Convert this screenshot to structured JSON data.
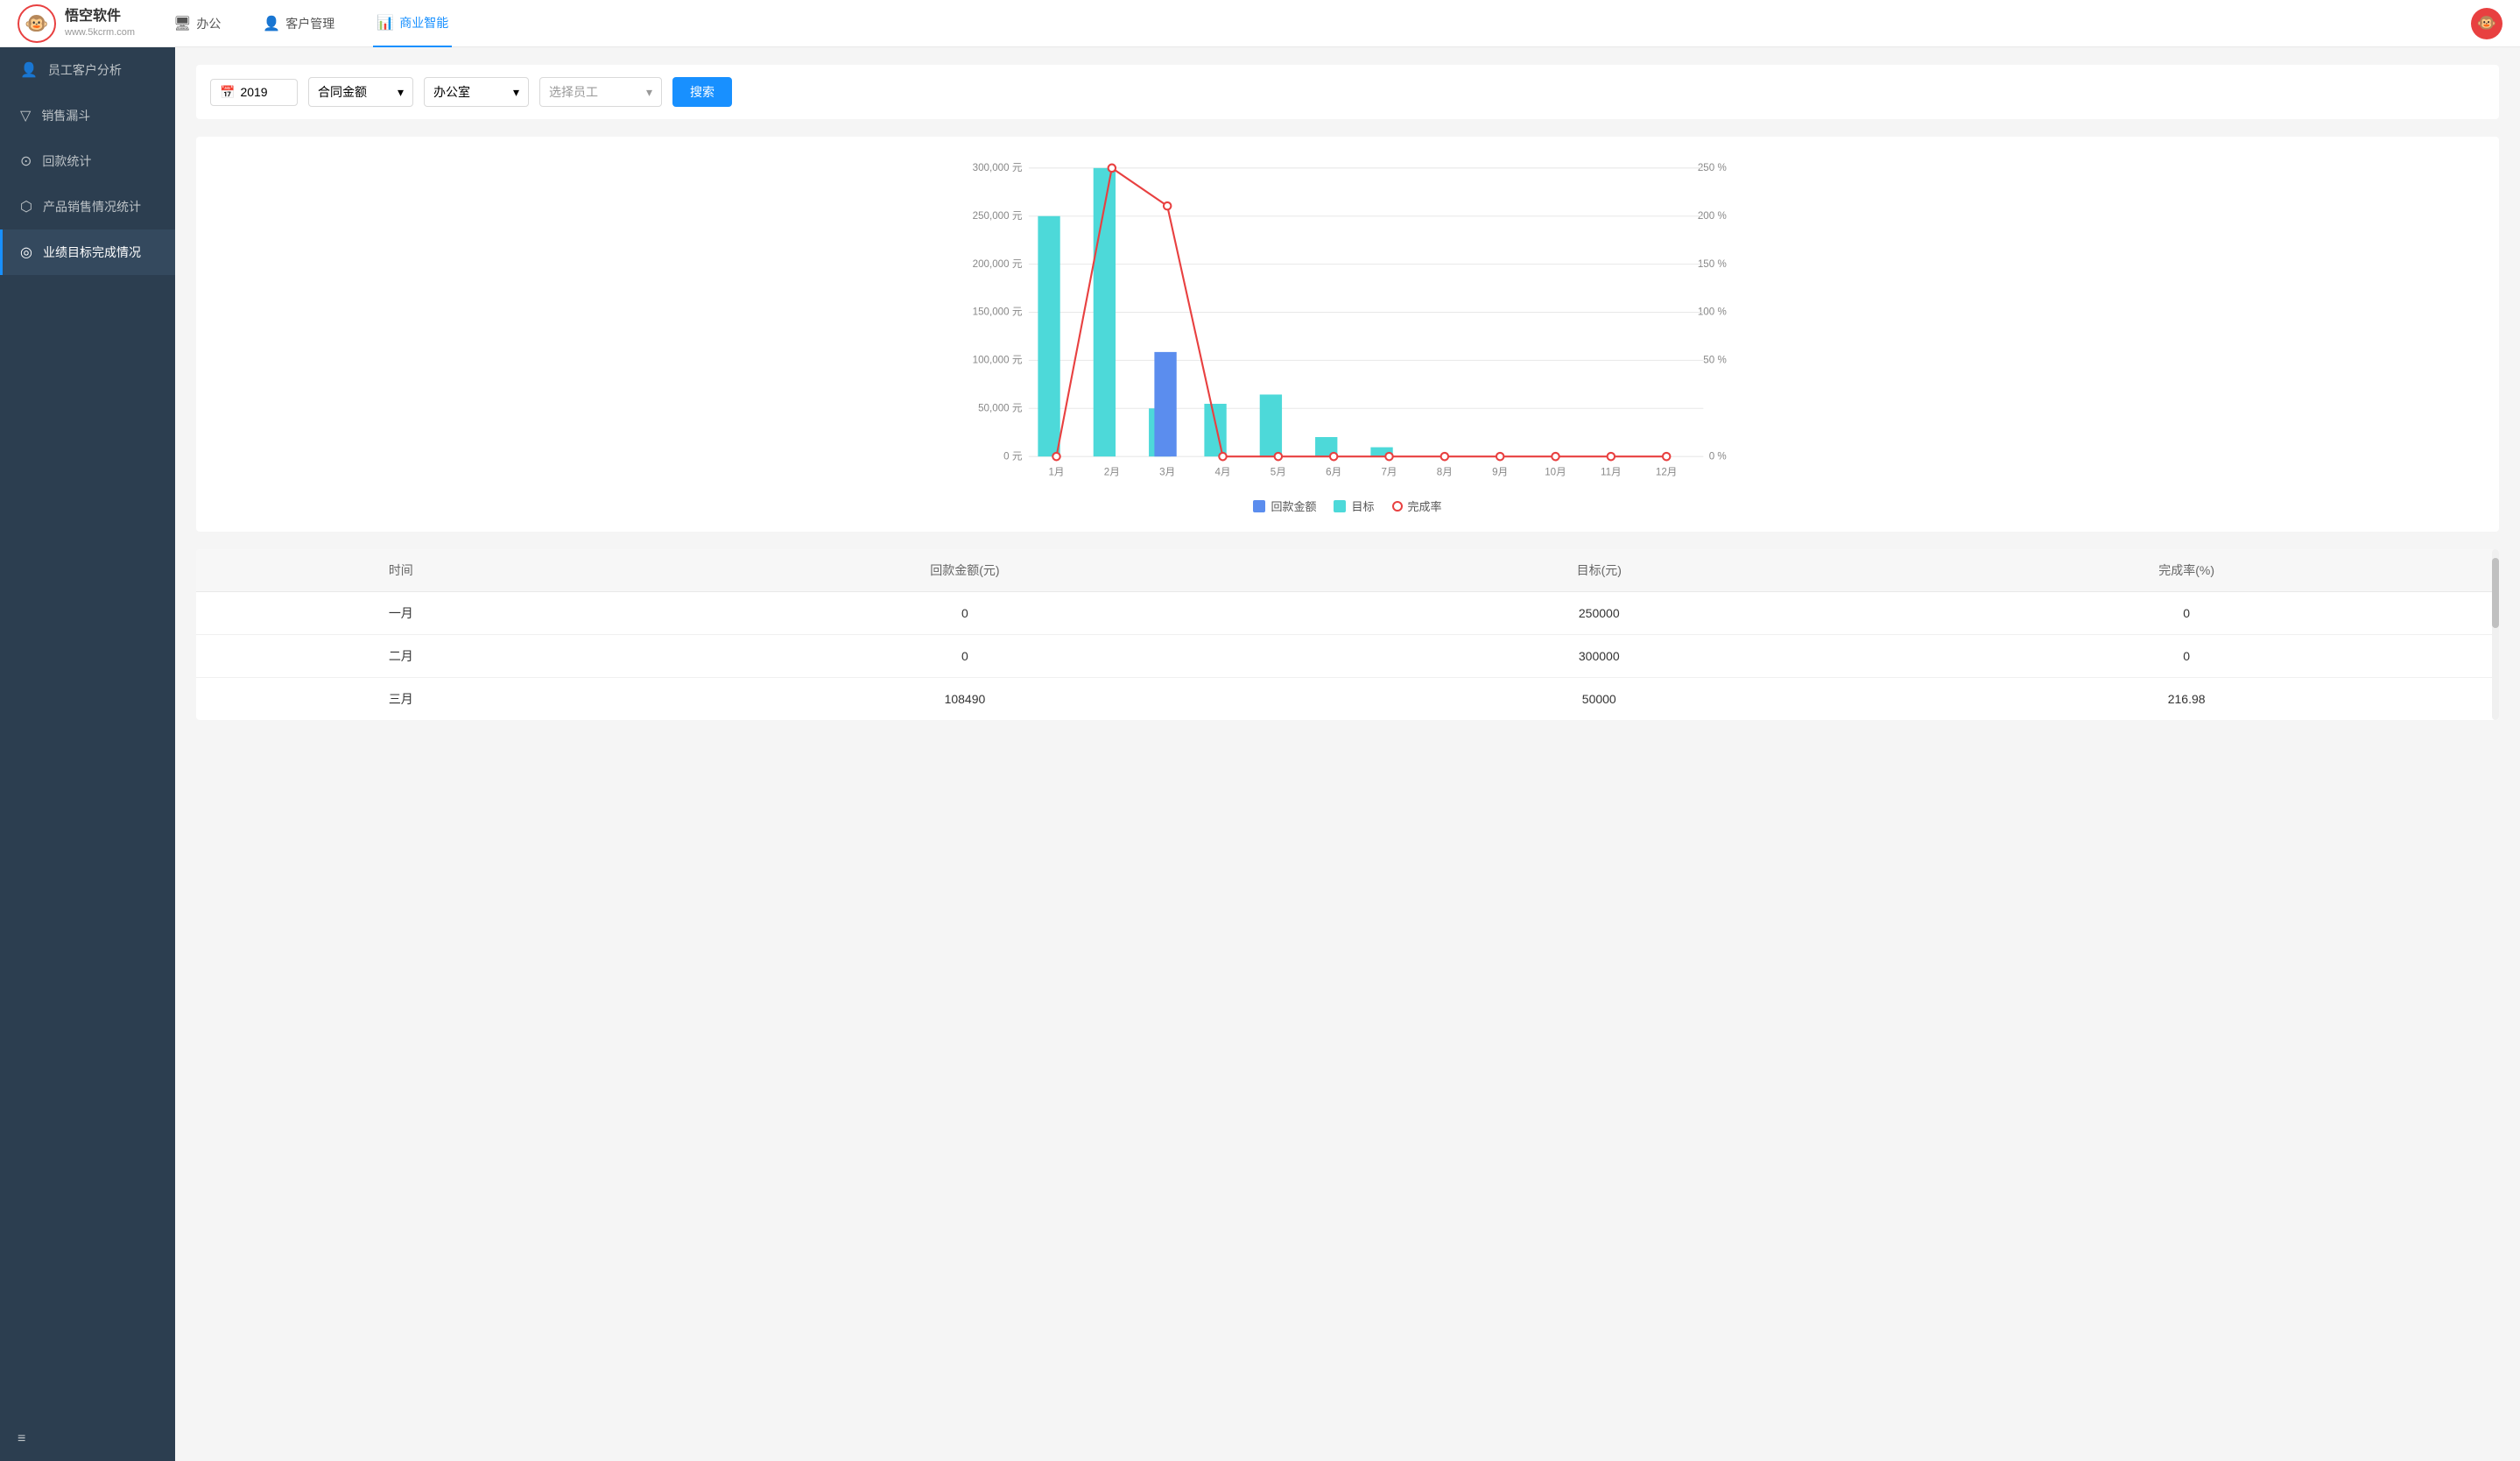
{
  "logo": {
    "icon": "🐵",
    "main_text": "悟空软件",
    "sub_text": "www.5kcrm.com"
  },
  "nav": {
    "items": [
      {
        "id": "office",
        "label": "办公",
        "icon": "🖥",
        "active": false
      },
      {
        "id": "customer",
        "label": "客户管理",
        "icon": "👤",
        "active": false
      },
      {
        "id": "bi",
        "label": "商业智能",
        "icon": "📊",
        "active": true
      }
    ]
  },
  "sidebar": {
    "items": [
      {
        "id": "employee-analysis",
        "label": "员工客户分析",
        "icon": "👤",
        "active": false
      },
      {
        "id": "sales-funnel",
        "label": "销售漏斗",
        "icon": "🔻",
        "active": false
      },
      {
        "id": "payment-stats",
        "label": "回款统计",
        "icon": "🔄",
        "active": false
      },
      {
        "id": "product-sales",
        "label": "产品销售情况统计",
        "icon": "📦",
        "active": false
      },
      {
        "id": "performance",
        "label": "业绩目标完成情况",
        "icon": "📍",
        "active": true
      }
    ],
    "bottom_icon": "≡"
  },
  "filters": {
    "year": "2019",
    "year_icon": "📅",
    "type": "合同金额",
    "department": "办公室",
    "employee_placeholder": "选择员工",
    "search_label": "搜索"
  },
  "chart": {
    "y_left_labels": [
      "300,000 元",
      "250,000 元",
      "200,000 元",
      "150,000 元",
      "100,000 元",
      "50,000 元",
      "0 元"
    ],
    "y_right_labels": [
      "250 %",
      "200 %",
      "150 %",
      "100 %",
      "50 %",
      "0 %"
    ],
    "x_labels": [
      "1月",
      "2月",
      "3月",
      "4月",
      "5月",
      "6月",
      "7月",
      "8月",
      "9月",
      "10月",
      "11月",
      "12月"
    ],
    "bars_huikuan": [
      0,
      0,
      108490,
      0,
      0,
      0,
      0,
      0,
      0,
      0,
      0,
      0
    ],
    "bars_mubiao": [
      250000,
      300000,
      50000,
      55000,
      65000,
      20000,
      10000,
      0,
      0,
      0,
      0,
      0
    ],
    "line_wancheng": [
      0,
      250,
      216.98,
      0,
      0,
      0,
      0,
      0,
      0,
      0,
      0,
      0
    ],
    "max_left": 300000,
    "max_right": 250,
    "legend": {
      "huikuan_label": "回款金额",
      "mubiao_label": "目标",
      "wancheng_label": "完成率"
    }
  },
  "table": {
    "headers": [
      "时间",
      "回款金额(元)",
      "目标(元)",
      "完成率(%)"
    ],
    "rows": [
      {
        "month": "一月",
        "huikuan": "0",
        "mubiao": "250000",
        "wancheng": "0"
      },
      {
        "month": "二月",
        "huikuan": "0",
        "mubiao": "300000",
        "wancheng": "0"
      },
      {
        "month": "三月",
        "huikuan": "108490",
        "mubiao": "50000",
        "wancheng": "216.98"
      }
    ]
  }
}
